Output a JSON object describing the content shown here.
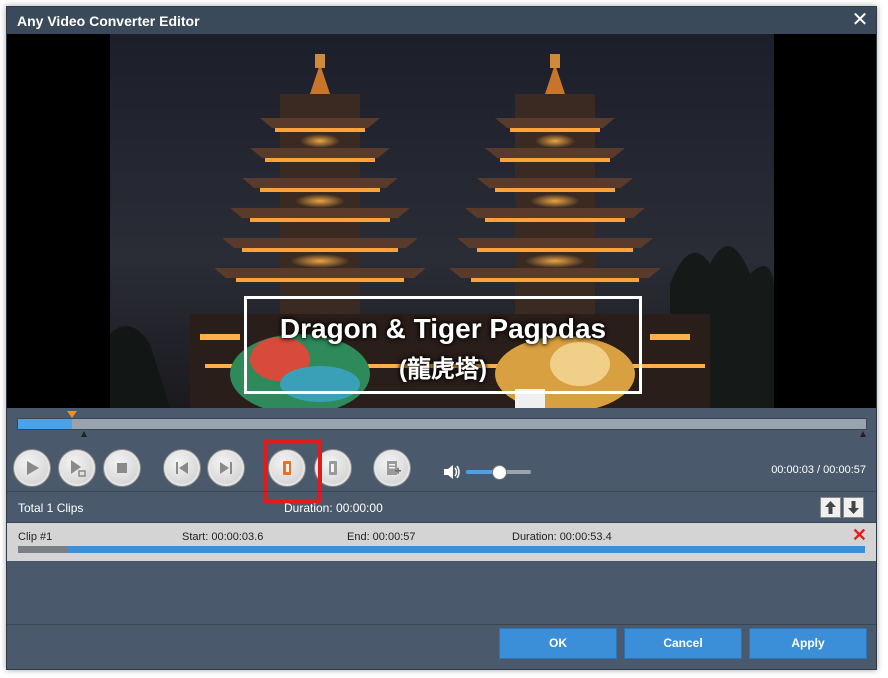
{
  "window": {
    "title": "Any Video Converter Editor"
  },
  "preview": {
    "overlay_line1": "Dragon & Tiger Pagpdas",
    "overlay_line2": "(龍虎塔)"
  },
  "player": {
    "time_readout": "00:00:03 / 00:00:57",
    "progress_fraction": 0.0632,
    "volume_fraction": 0.5
  },
  "clips_info": {
    "total_clips": "Total 1 Clips",
    "duration": "Duration: 00:00:00"
  },
  "clips": [
    {
      "name": "Clip #1",
      "start": "Start: 00:00:03.6",
      "end": "End: 00:00:57",
      "duration": "Duration: 00:00:53.4",
      "start_fraction": 0.0596,
      "end_fraction": 1.0
    }
  ],
  "footer": {
    "ok_label": "OK",
    "cancel_label": "Cancel",
    "apply_label": "Apply"
  },
  "colors": {
    "accent": "#3b8fd9",
    "highlight": "#e11b1b",
    "marker": "#f0901e"
  },
  "icons": [
    "close-icon",
    "play-icon",
    "play-selection-icon",
    "stop-icon",
    "previous-frame-icon",
    "next-frame-icon",
    "set-start-icon",
    "set-end-icon",
    "add-clip-icon",
    "volume-icon",
    "move-up-icon",
    "move-down-icon",
    "delete-icon"
  ]
}
